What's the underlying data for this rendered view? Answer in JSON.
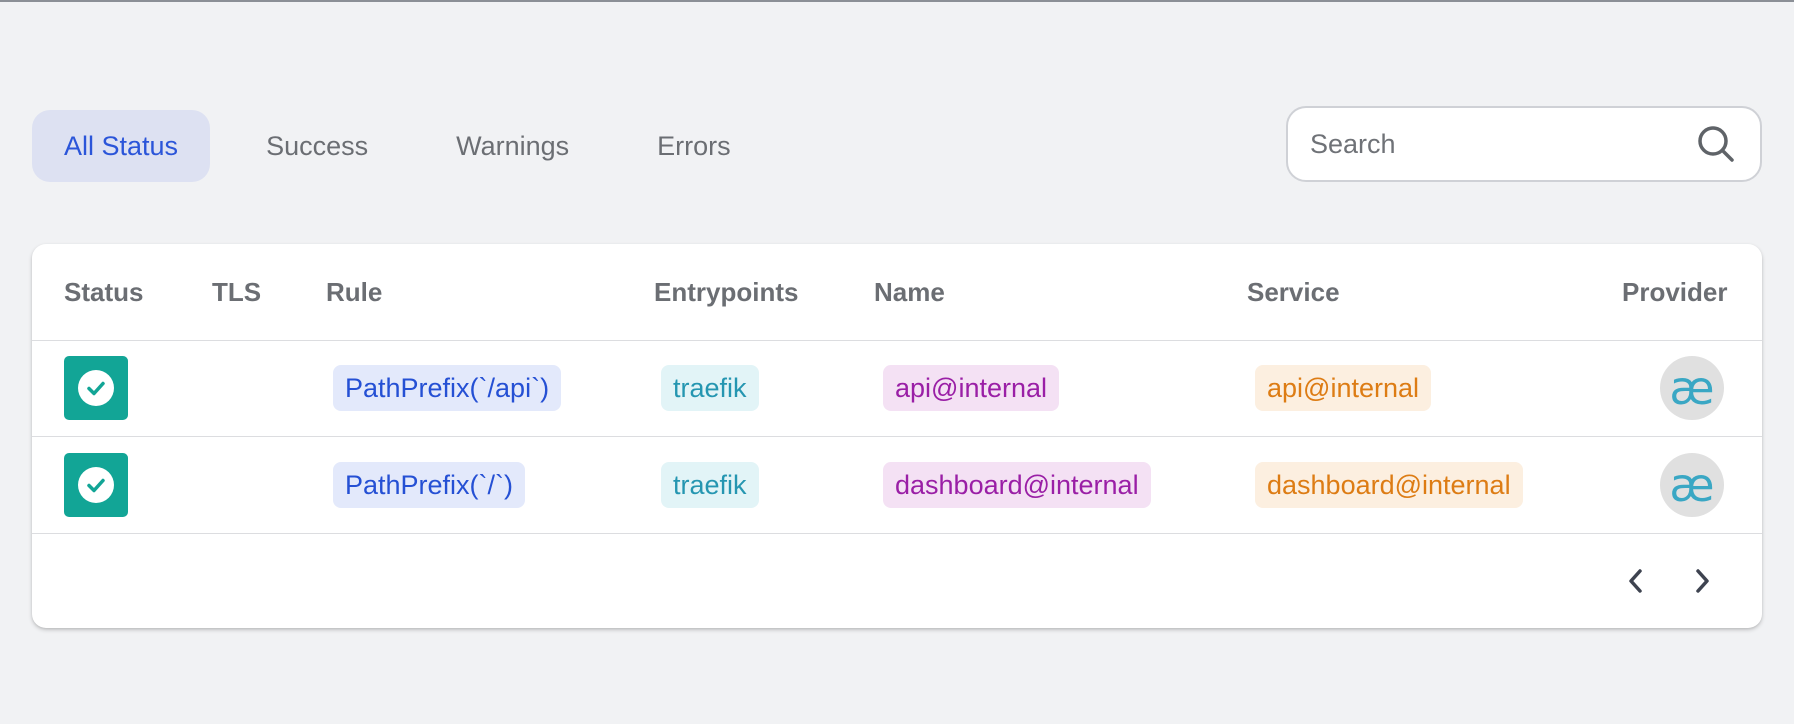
{
  "filters": {
    "tabs": [
      {
        "label": "All Status",
        "active": true
      },
      {
        "label": "Success",
        "active": false
      },
      {
        "label": "Warnings",
        "active": false
      },
      {
        "label": "Errors",
        "active": false
      }
    ]
  },
  "search": {
    "placeholder": "Search",
    "value": "",
    "icon": "search-icon"
  },
  "table": {
    "headers": {
      "status": "Status",
      "tls": "TLS",
      "rule": "Rule",
      "entrypoints": "Entrypoints",
      "name": "Name",
      "service": "Service",
      "provider": "Provider"
    },
    "rows": [
      {
        "status": "success",
        "tls": "",
        "rule": "PathPrefix(`/api`)",
        "entrypoints": "traefik",
        "name": "api@internal",
        "service": "api@internal",
        "provider_glyph": "æ"
      },
      {
        "status": "success",
        "tls": "",
        "rule": "PathPrefix(`/`)",
        "entrypoints": "traefik",
        "name": "dashboard@internal",
        "service": "dashboard@internal",
        "provider_glyph": "æ"
      }
    ]
  },
  "pagination": {
    "prev_icon": "chevron-left-icon",
    "next_icon": "chevron-right-icon"
  },
  "colors": {
    "accent": "#2b55d9",
    "success": "#12a596",
    "rule_chip": "#2550d4",
    "entry_chip": "#2596b1",
    "name_chip": "#9a1fa6",
    "service_chip": "#dd7c14",
    "provider_icon": "#3aa7c4"
  }
}
